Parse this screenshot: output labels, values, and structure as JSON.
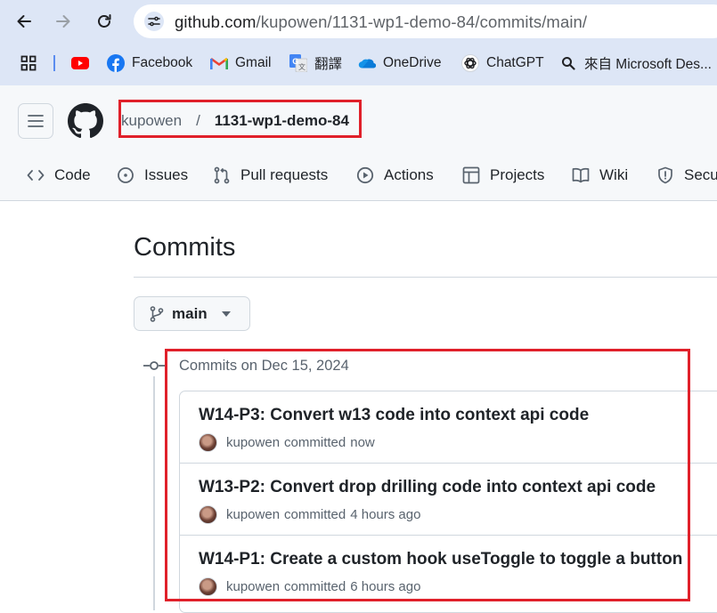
{
  "browser": {
    "address_host": "github.com",
    "address_path": "/kupowen/1131-wp1-demo-84/commits/main/",
    "bookmarks": [
      {
        "label": "",
        "icon": "apps-grid-icon"
      },
      {
        "label": "",
        "icon": "youtube-icon"
      },
      {
        "label": "Facebook",
        "icon": "facebook-icon"
      },
      {
        "label": "Gmail",
        "icon": "gmail-icon"
      },
      {
        "label": "翻譯",
        "icon": "google-translate-icon"
      },
      {
        "label": "OneDrive",
        "icon": "onedrive-icon"
      },
      {
        "label": "ChatGPT",
        "icon": "chatgpt-icon"
      },
      {
        "label": "來自 Microsoft Des...",
        "icon": "search-icon"
      }
    ]
  },
  "header": {
    "owner": "kupowen",
    "separator": "/",
    "repo": "1131-wp1-demo-84",
    "tabs": [
      {
        "label": "Code",
        "icon": "code-icon"
      },
      {
        "label": "Issues",
        "icon": "issue-opened-icon"
      },
      {
        "label": "Pull requests",
        "icon": "git-pull-request-icon"
      },
      {
        "label": "Actions",
        "icon": "play-icon"
      },
      {
        "label": "Projects",
        "icon": "table-icon"
      },
      {
        "label": "Wiki",
        "icon": "book-icon"
      },
      {
        "label": "Secu",
        "icon": "shield-icon"
      }
    ]
  },
  "main": {
    "title": "Commits",
    "branch": "main",
    "group_label": "Commits on Dec 15, 2024",
    "commits": [
      {
        "title": "W14-P3: Convert w13 code into context api code",
        "author": "kupowen",
        "verb": "committed",
        "time": "now"
      },
      {
        "title": "W13-P2: Convert drop drilling code into context api code",
        "author": "kupowen",
        "verb": "committed",
        "time": "4 hours ago"
      },
      {
        "title": "W14-P1: Create a custom hook useToggle to toggle a button",
        "author": "kupowen",
        "verb": "committed",
        "time": "6 hours ago"
      }
    ]
  },
  "colors": {
    "highlight_box": "#e0202a",
    "browser_bar": "#dde6f6",
    "header_bg": "#f6f8fa"
  }
}
